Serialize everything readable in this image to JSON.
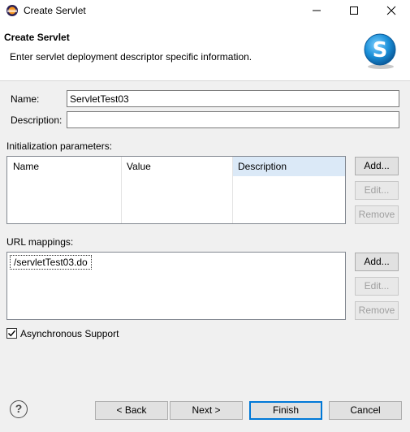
{
  "window": {
    "title": "Create Servlet"
  },
  "header": {
    "title": "Create Servlet",
    "description": "Enter servlet deployment descriptor specific information."
  },
  "form": {
    "name_label": "Name:",
    "name_value": "ServletTest03",
    "description_label": "Description:",
    "description_value": ""
  },
  "init_params": {
    "label": "Initialization parameters:",
    "columns": [
      "Name",
      "Value",
      "Description"
    ],
    "rows": [],
    "buttons": {
      "add": "Add...",
      "edit": "Edit...",
      "remove": "Remove"
    }
  },
  "url_mappings": {
    "label": "URL mappings:",
    "items": [
      "/servletTest03.do"
    ],
    "buttons": {
      "add": "Add...",
      "edit": "Edit...",
      "remove": "Remove"
    }
  },
  "async": {
    "label": "Asynchronous Support",
    "checked": true
  },
  "footer": {
    "back": "< Back",
    "next": "Next >",
    "finish": "Finish",
    "cancel": "Cancel"
  },
  "icons": {
    "app": "eclipse-icon",
    "help": "help-icon",
    "banner": "servlet-banner-icon"
  },
  "colors": {
    "selected_column_header": "#dbe9f7",
    "default_button_border": "#0078d7",
    "banner_blue": "#1a8fd8"
  }
}
